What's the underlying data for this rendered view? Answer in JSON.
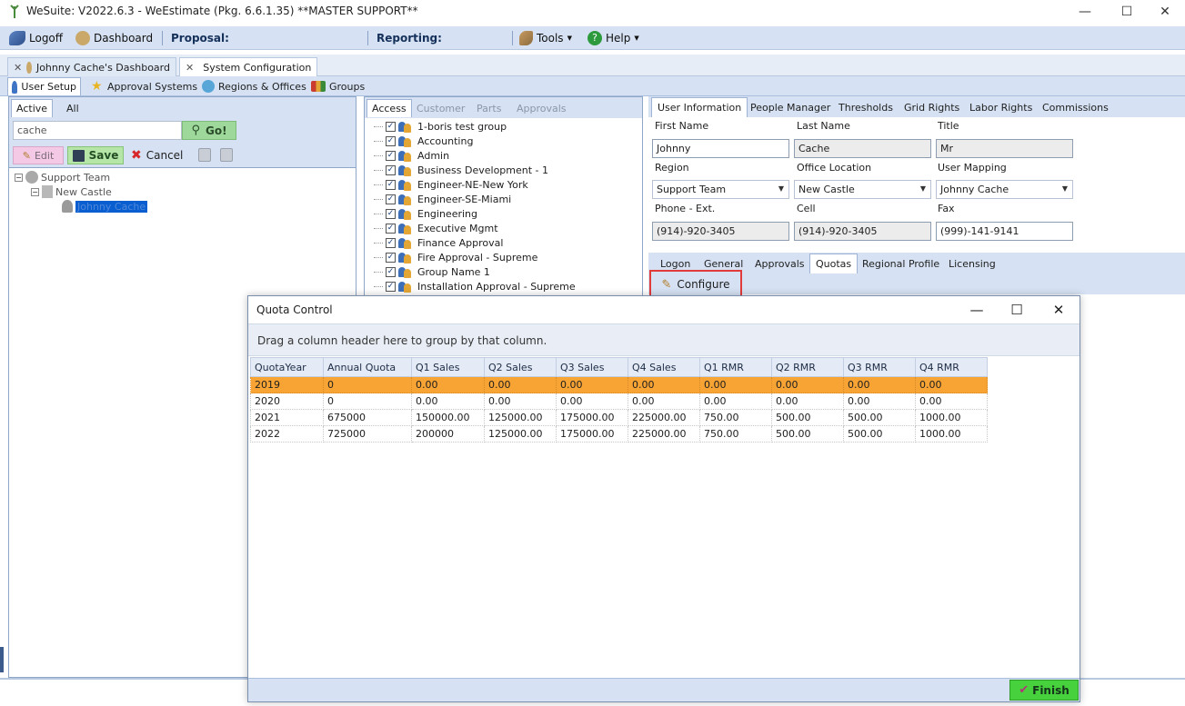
{
  "window": {
    "title": "WeSuite: V2022.6.3 - WeEstimate (Pkg. 6.6.1.35) **MASTER SUPPORT**"
  },
  "menu": {
    "logoff": "Logoff",
    "dashboard": "Dashboard",
    "proposal": "Proposal:",
    "reporting": "Reporting:",
    "tools": "Tools",
    "help": "Help"
  },
  "doc_tabs": [
    "Johnny Cache's Dashboard",
    "System Configuration"
  ],
  "sub_tabs": [
    "User Setup",
    "Approval Systems",
    "Regions & Offices",
    "Groups"
  ],
  "left_panel": {
    "tabs": [
      "Active",
      "All"
    ],
    "search_value": "cache",
    "go_label": "Go!",
    "edit_label": "Edit",
    "save_label": "Save",
    "cancel_label": "Cancel",
    "tree": {
      "root": "Support Team",
      "office": "New Castle",
      "user": "Johnny Cache"
    }
  },
  "access_panel": {
    "tabs": [
      "Access",
      "Customer",
      "Parts",
      "Approvals"
    ],
    "groups": [
      "1-boris test group",
      "Accounting",
      "Admin",
      "Business Development - 1",
      "Engineer-NE-New York",
      "Engineer-SE-Miami",
      "Engineering",
      "Executive Mgmt",
      "Finance Approval",
      "Fire Approval - Supreme",
      "Group Name 1",
      "Installation Approval - Supreme"
    ]
  },
  "right_panel": {
    "tabs": [
      "User Information",
      "People Manager",
      "Thresholds",
      "Grid Rights",
      "Labor Rights",
      "Commissions"
    ],
    "labels": {
      "first_name": "First Name",
      "last_name": "Last Name",
      "title": "Title",
      "region": "Region",
      "office_location": "Office Location",
      "user_mapping": "User Mapping",
      "phone": "Phone - Ext.",
      "cell": "Cell",
      "fax": "Fax"
    },
    "values": {
      "first_name": "Johnny",
      "last_name": "Cache",
      "title": "Mr",
      "region": "Support Team",
      "office_location": "New Castle",
      "user_mapping": "Johnny Cache",
      "phone": "(914)-920-3405",
      "cell": "(914)-920-3405",
      "fax": "(999)-141-9141"
    },
    "bottom_tabs": [
      "Logon",
      "General",
      "Approvals",
      "Quotas",
      "Regional Profile",
      "Licensing"
    ],
    "configure_label": "Configure"
  },
  "dialog": {
    "title": "Quota Control",
    "group_hint": "Drag a column header here to group by that column.",
    "columns": [
      "QuotaYear",
      "Annual Quota",
      "Q1 Sales",
      "Q2 Sales",
      "Q3 Sales",
      "Q4 Sales",
      "Q1 RMR",
      "Q2 RMR",
      "Q3 RMR",
      "Q4 RMR"
    ],
    "rows": [
      [
        "2019",
        "0",
        "0.00",
        "0.00",
        "0.00",
        "0.00",
        "0.00",
        "0.00",
        "0.00",
        "0.00"
      ],
      [
        "2020",
        "0",
        "0.00",
        "0.00",
        "0.00",
        "0.00",
        "0.00",
        "0.00",
        "0.00",
        "0.00"
      ],
      [
        "2021",
        "675000",
        "150000.00",
        "125000.00",
        "175000.00",
        "225000.00",
        "750.00",
        "500.00",
        "500.00",
        "1000.00"
      ],
      [
        "2022",
        "725000",
        "200000",
        "125000.00",
        "175000.00",
        "225000.00",
        "750.00",
        "500.00",
        "500.00",
        "1000.00"
      ]
    ],
    "finish_label": "Finish"
  }
}
